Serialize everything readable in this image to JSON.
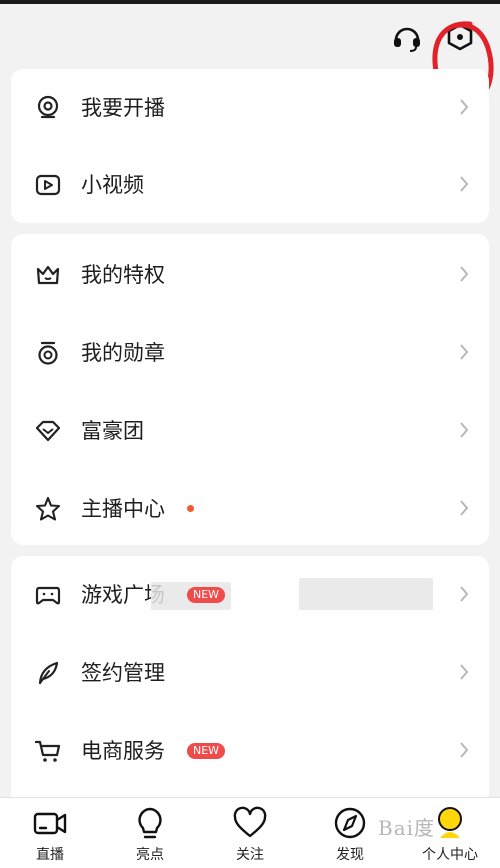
{
  "section1": [
    {
      "label": "我要开播",
      "icon": "live-camera-icon"
    },
    {
      "label": "小视频",
      "icon": "video-play-icon"
    }
  ],
  "section2": [
    {
      "label": "我的特权",
      "icon": "crown-icon"
    },
    {
      "label": "我的勋章",
      "icon": "medal-icon"
    },
    {
      "label": "富豪团",
      "icon": "diamond-icon"
    },
    {
      "label": "主播中心",
      "icon": "star-icon",
      "has_dot": true
    }
  ],
  "section3": [
    {
      "label": "游戏广场",
      "icon": "gamepad-icon",
      "badge": "NEW"
    },
    {
      "label": "签约管理",
      "icon": "feather-icon"
    },
    {
      "label": "电商服务",
      "icon": "cart-icon",
      "badge": "NEW"
    }
  ],
  "header": {
    "icons": [
      "headset-icon",
      "settings-icon"
    ]
  },
  "tabs": [
    {
      "label": "直播",
      "icon": "camera-icon"
    },
    {
      "label": "亮点",
      "icon": "bulb-icon"
    },
    {
      "label": "关注",
      "icon": "heart-icon"
    },
    {
      "label": "发现",
      "icon": "compass-icon"
    },
    {
      "label": "个人中心",
      "icon": "person-icon",
      "active": true
    }
  ],
  "watermark": "Bai度",
  "colors": {
    "badge": "#ef4b4b",
    "dot": "#f05a2a",
    "active_tab": "#ffd60a",
    "annotation": "#e0232a"
  }
}
